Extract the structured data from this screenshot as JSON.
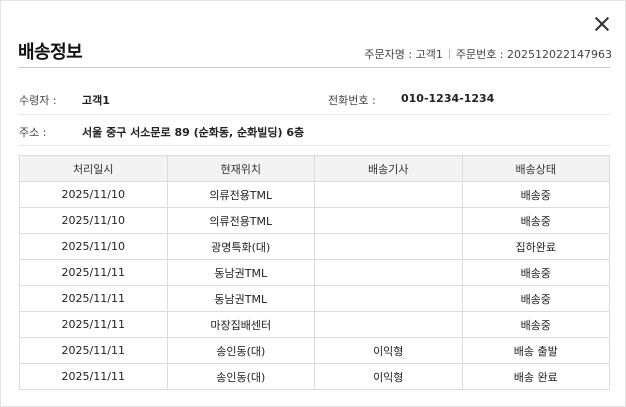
{
  "dialog": {
    "title": "배송정보",
    "orderer": "주문자명 : 고객1",
    "order_number": "주문번호 : 202512022147963"
  },
  "info": {
    "recipient_label": "수령자 :",
    "recipient_value": "고객1",
    "phone_label": "전화번호 :",
    "phone_value": "010-1234-1234",
    "address_label": "주소 :",
    "address_value": "서울 중구 서소문로 89 (순화동, 순화빌딩) 6층"
  },
  "table": {
    "headers": [
      "처리일시",
      "현재위치",
      "배송기사",
      "배송상태"
    ],
    "rows": [
      [
        "2025/11/10",
        "의류전용TML",
        "",
        "배송중"
      ],
      [
        "2025/11/10",
        "의류전용TML",
        "",
        "배송중"
      ],
      [
        "2025/11/10",
        "광명특화(대)",
        "",
        "집하완료"
      ],
      [
        "2025/11/11",
        "동남권TML",
        "",
        "배송중"
      ],
      [
        "2025/11/11",
        "동남권TML",
        "",
        "배송중"
      ],
      [
        "2025/11/11",
        "마장집배센터",
        "",
        "배송중"
      ],
      [
        "2025/11/11",
        "송인동(대)",
        "이익형",
        "배송 출발"
      ],
      [
        "2025/11/11",
        "송인동(대)",
        "이익형",
        "배송 완료"
      ]
    ]
  }
}
